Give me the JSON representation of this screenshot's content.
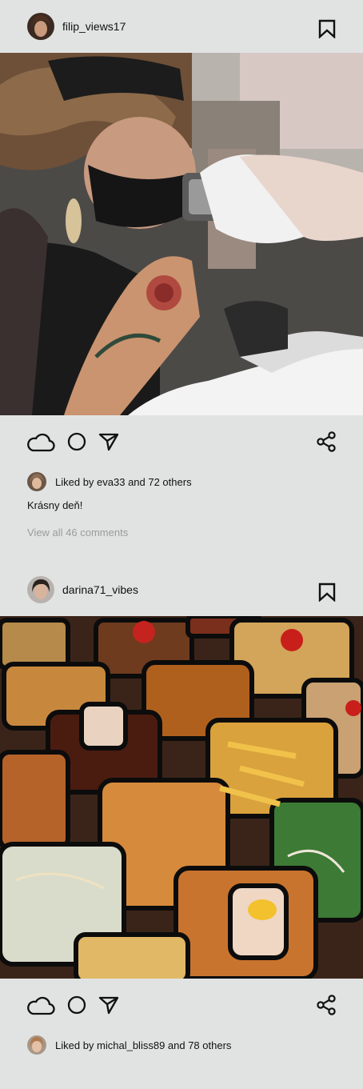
{
  "posts": [
    {
      "username": "filip_views17",
      "image_subject": "tattoo",
      "liked_by_text": "Liked by eva33 and 72 others",
      "caption": "Krásny deň!",
      "comments_link": "View all 46 comments"
    },
    {
      "username": "darina71_vibes",
      "image_subject": "food",
      "liked_by_text": "Liked by michal_bliss89 and 78 others"
    }
  ],
  "icons": {
    "like": "cloud-icon",
    "comment": "circle-icon",
    "send": "send-icon",
    "share": "share-icon",
    "bookmark": "bookmark-icon"
  },
  "colors": {
    "background": "#e1e3e3",
    "text": "#111111",
    "muted_text": "#9a9c9c"
  }
}
